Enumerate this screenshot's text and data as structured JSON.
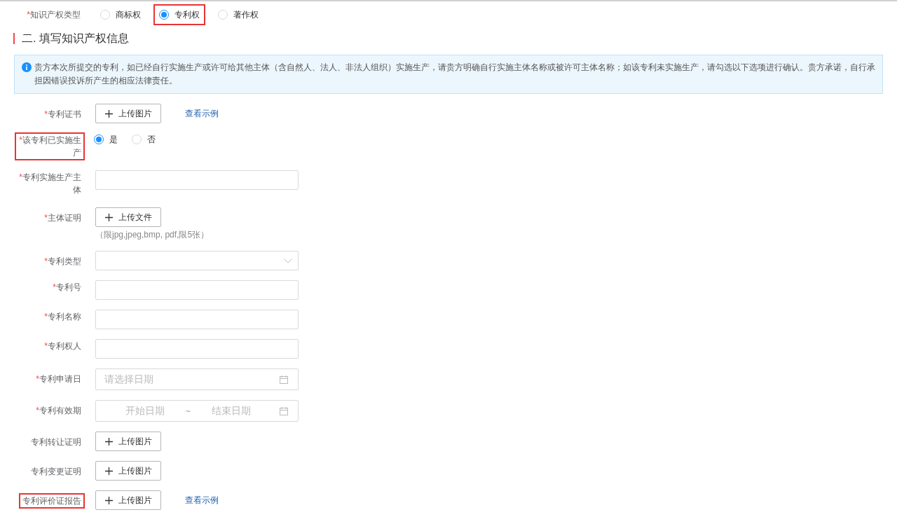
{
  "ip_type": {
    "label": "知识产权类型",
    "required_mark": "*",
    "options": [
      {
        "label": "商标权",
        "selected": false,
        "highlighted": false
      },
      {
        "label": "专利权",
        "selected": true,
        "highlighted": true
      },
      {
        "label": "著作权",
        "selected": false,
        "highlighted": false
      }
    ]
  },
  "section_title": "二. 填写知识产权信息",
  "notice": "贵方本次所提交的专利，如已经自行实施生产或许可给其他主体（含自然人、法人、非法人组织）实施生产，请贵方明确自行实施主体名称或被许可主体名称；如该专利未实施生产，请勾选以下选项进行确认。贵方承诺，自行承担因错误投诉所产生的相应法律责任。",
  "fields": [
    {
      "kind": "upload",
      "label": "专利证书",
      "required_mark": "*",
      "highlighted": false,
      "button": "上传图片",
      "link": "查看示例"
    },
    {
      "kind": "radio",
      "label": "该专利已实施生产",
      "required_mark": "*",
      "highlighted": true,
      "options": [
        {
          "label": "是",
          "selected": true
        },
        {
          "label": "否",
          "selected": false
        }
      ]
    },
    {
      "kind": "text",
      "label": "专利实施生产主体",
      "required_mark": "*",
      "highlighted": false
    },
    {
      "kind": "upload",
      "label": "主体证明",
      "required_mark": "*",
      "highlighted": false,
      "button": "上传文件",
      "hint": "（限jpg,jpeg,bmp, pdf,限5张）"
    },
    {
      "kind": "select",
      "label": "专利类型",
      "required_mark": "*",
      "highlighted": false
    },
    {
      "kind": "text",
      "label": "专利号",
      "required_mark": "*",
      "highlighted": false
    },
    {
      "kind": "text",
      "label": "专利名称",
      "required_mark": "*",
      "highlighted": false
    },
    {
      "kind": "text",
      "label": "专利权人",
      "required_mark": "*",
      "highlighted": false
    },
    {
      "kind": "date",
      "label": "专利申请日",
      "required_mark": "*",
      "highlighted": false,
      "placeholder": "请选择日期"
    },
    {
      "kind": "daterange",
      "label": "专利有效期",
      "required_mark": "*",
      "highlighted": false,
      "start_placeholder": "开始日期",
      "separator": "~",
      "end_placeholder": "结束日期"
    },
    {
      "kind": "upload",
      "label": "专利转让证明",
      "highlighted": false,
      "button": "上传图片"
    },
    {
      "kind": "upload",
      "label": "专利变更证明",
      "highlighted": false,
      "button": "上传图片"
    },
    {
      "kind": "upload",
      "label": "专利评价证报告",
      "highlighted": true,
      "button": "上传图片",
      "link": "查看示例"
    }
  ]
}
